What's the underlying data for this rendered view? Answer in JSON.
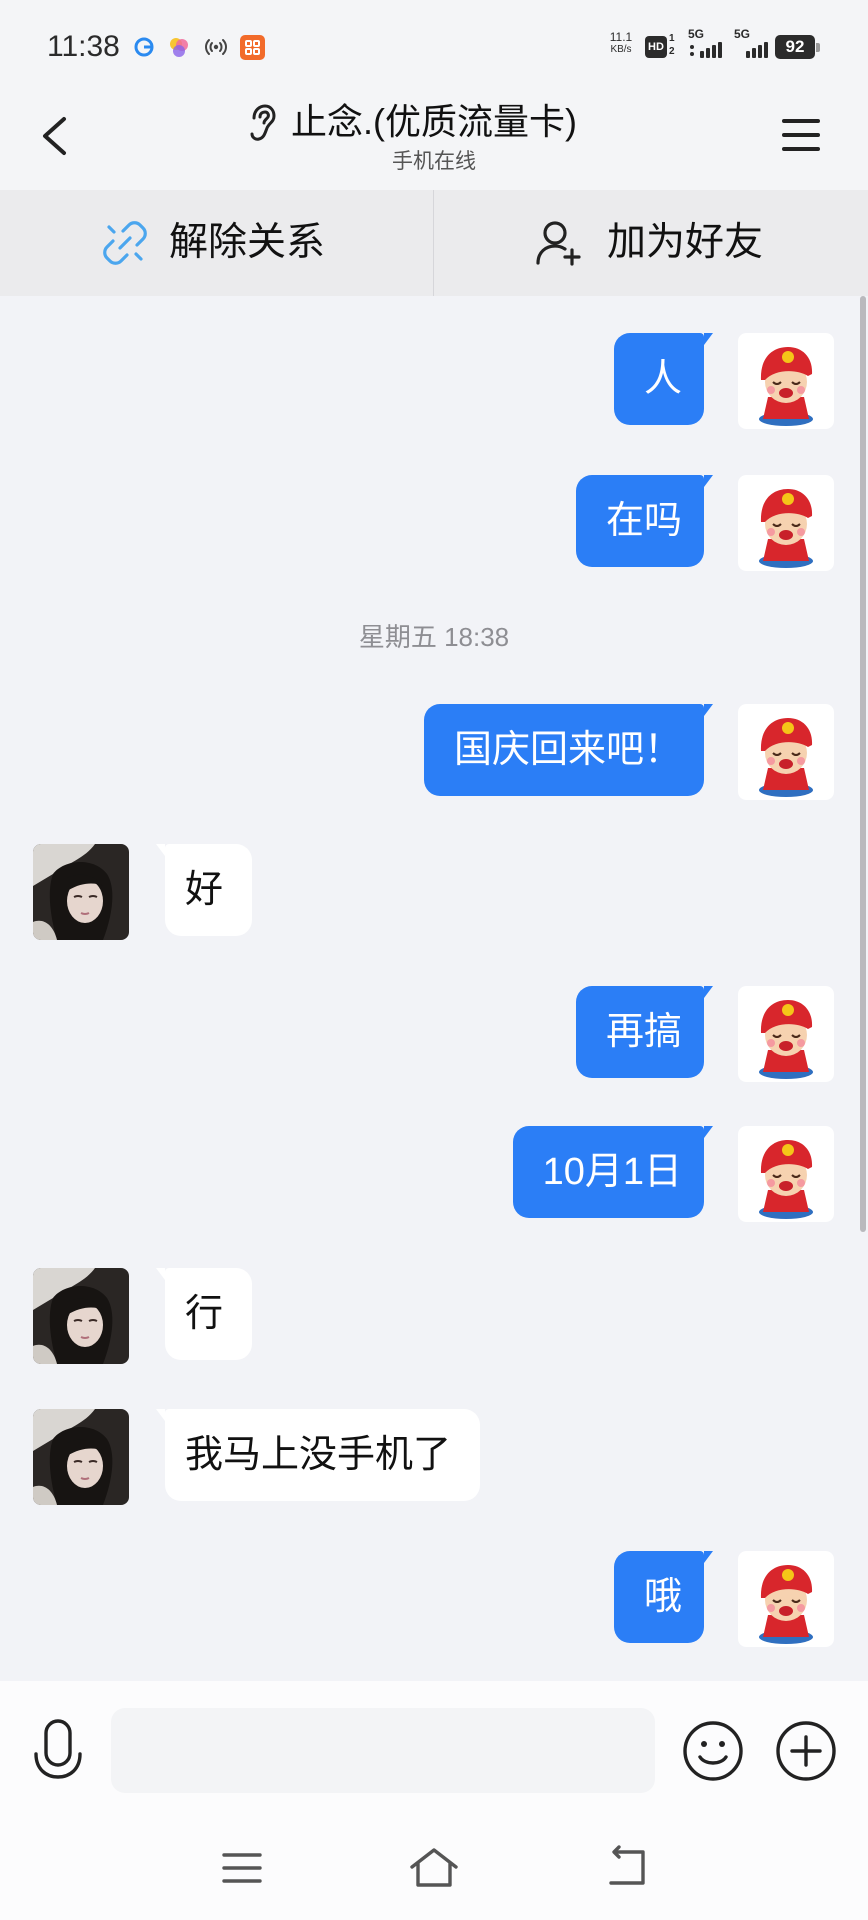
{
  "status_bar": {
    "time": "11:38",
    "net_speed_value": "11.1",
    "net_speed_unit": "KB/s",
    "hd": "HD",
    "hd_sim1": "1",
    "hd_sim2": "2",
    "sim1_network": "5G",
    "sim2_network": "5G",
    "battery": "92",
    "notification_icons": [
      "browser-icon",
      "photos-icon",
      "hotspot-icon",
      "app-icon"
    ]
  },
  "header": {
    "title": "止念.(优质流量卡)",
    "subtitle": "手机在线",
    "icons": {
      "back": "chevron-left-icon",
      "mode": "ear-icon",
      "menu": "menu-icon"
    }
  },
  "actions": {
    "unfriend_label": "解除关系",
    "add_friend_label": "加为好友",
    "icons": {
      "unfriend": "broken-link-icon",
      "add_friend": "add-user-icon"
    }
  },
  "messages": [
    {
      "side": "right",
      "text": "人"
    },
    {
      "side": "right",
      "text": "在吗"
    },
    {
      "type": "timestamp",
      "text": "星期五 18:38"
    },
    {
      "side": "right",
      "text": "国庆回来吧！"
    },
    {
      "side": "left",
      "text": "好"
    },
    {
      "side": "right",
      "text": "再搞"
    },
    {
      "side": "right",
      "text": "10月1日"
    },
    {
      "side": "left",
      "text": "行"
    },
    {
      "side": "left",
      "text": "我马上没手机了"
    },
    {
      "side": "right",
      "text": "哦"
    }
  ],
  "composer": {
    "placeholder": "",
    "value": "",
    "icons": {
      "voice": "microphone-icon",
      "emoji": "smile-icon",
      "more": "plus-icon"
    }
  },
  "nav_bar": {
    "icons": {
      "recents": "menu-lines-icon",
      "home": "home-icon",
      "back": "back-icon"
    }
  },
  "colors": {
    "outgoing_bubble": "#2b7ef6",
    "incoming_bubble": "#ffffff",
    "chat_background": "#f2f3f7",
    "action_bar": "#ebebed",
    "link_icon": "#4ba6ee"
  }
}
